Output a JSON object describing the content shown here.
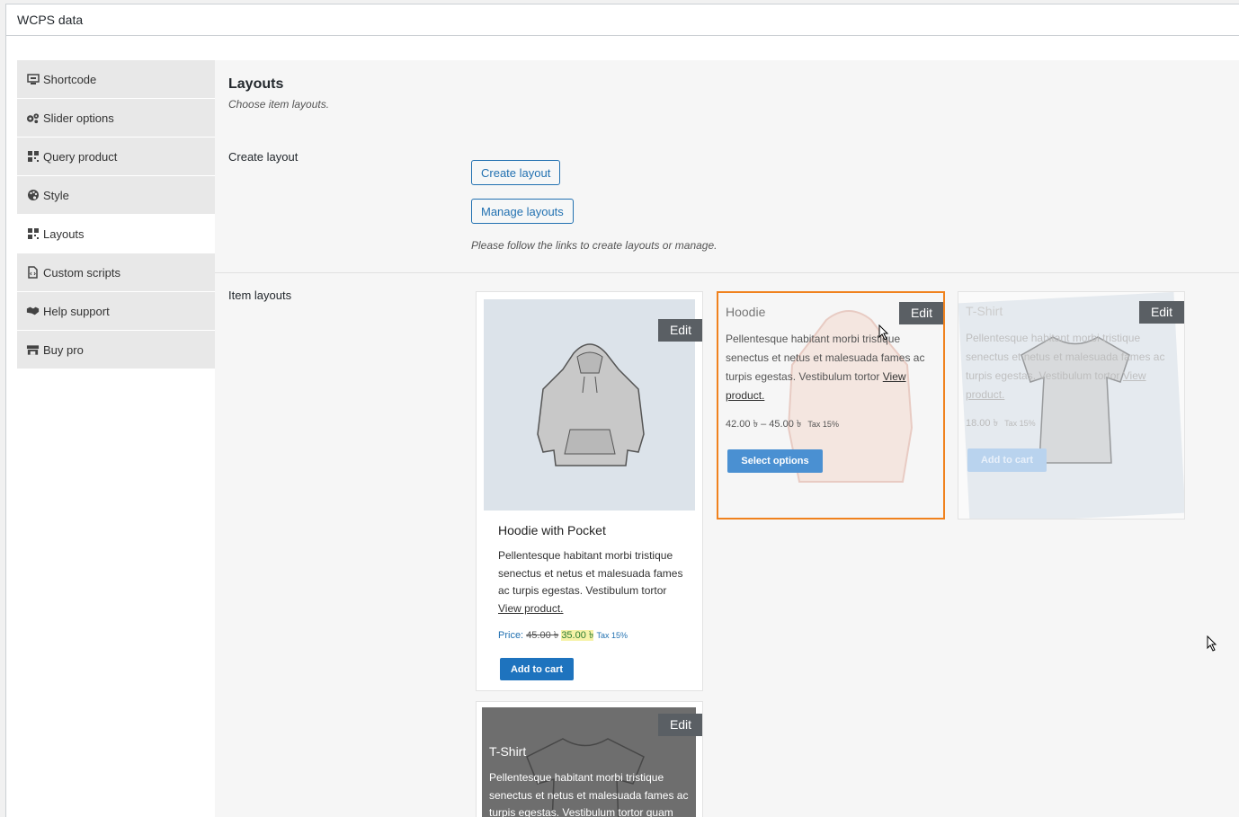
{
  "panel": {
    "title": "WCPS data"
  },
  "sidebar": {
    "items": [
      {
        "label": "Shortcode",
        "icon": "monitor-icon"
      },
      {
        "label": "Slider options",
        "icon": "gears-icon"
      },
      {
        "label": "Query product",
        "icon": "grid-icon"
      },
      {
        "label": "Style",
        "icon": "palette-icon"
      },
      {
        "label": "Layouts",
        "icon": "grid-icon",
        "active": true
      },
      {
        "label": "Custom scripts",
        "icon": "file-code-icon"
      },
      {
        "label": "Help support",
        "icon": "handshake-icon"
      },
      {
        "label": "Buy pro",
        "icon": "store-icon"
      }
    ]
  },
  "main": {
    "title": "Layouts",
    "description": "Choose item layouts.",
    "create_layout_label": "Create layout",
    "create_button": "Create layout",
    "manage_button": "Manage layouts",
    "follow_note": "Please follow the links to create layouts or manage.",
    "item_layouts_label": "Item layouts"
  },
  "layouts": [
    {
      "edit": "Edit",
      "title": "Hoodie with Pocket",
      "desc_lines": [
        "Pellentesque habitant morbi tristique",
        "senectus et netus et malesuada fames",
        "ac turpis egestas. Vestibulum tortor"
      ],
      "link": "View product.",
      "price_label": "Price:",
      "old_price": "45.00 ৳",
      "new_price": "35.00 ৳",
      "tax": "Tax 15%",
      "button": "Add to cart"
    },
    {
      "edit": "Edit",
      "title": "Hoodie",
      "desc_lines": [
        "Pellentesque habitant morbi tristique",
        "senectus et netus et malesuada fames ac",
        "turpis egestas. Vestibulum tortor"
      ],
      "desc_link_inline": "View",
      "link": "product.",
      "price": "42.00 ৳  – 45.00 ৳",
      "tax": "Tax 15%",
      "button": "Select options",
      "selected": true
    },
    {
      "edit": "Edit",
      "title": "T-Shirt",
      "desc_lines": [
        "Pellentesque habitant morbi tristique",
        "senectus et netus et malesuada fames ac",
        "turpis egestas. Vestibulum tortor"
      ],
      "desc_link_inline": "View",
      "link": "product.",
      "price": "18.00 ৳",
      "tax": "Tax 15%",
      "button": "Add to cart"
    },
    {
      "edit": "Edit",
      "title": "T-Shirt",
      "desc_lines": [
        "Pellentesque habitant morbi tristique",
        "senectus et netus et malesuada fames ac",
        "turpis egestas. Vestibulum tortor quam"
      ]
    }
  ],
  "colors": {
    "accent": "#2271b1",
    "selected_border": "#f0821e",
    "cart_button": "#1e73be",
    "select_button": "#4a90d2",
    "edit_bg": "#5a5f64"
  }
}
